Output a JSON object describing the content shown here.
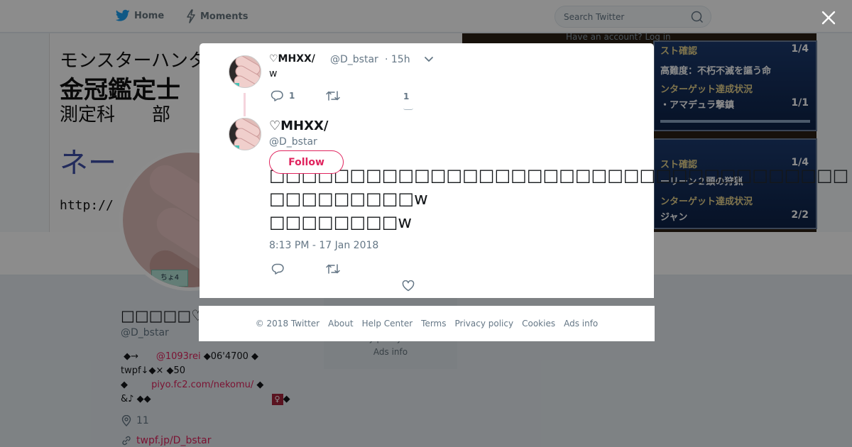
{
  "nav": {
    "home_label": "Home",
    "moments_label": "Moments",
    "search_placeholder": "Search Twitter",
    "login_hint": "Have an account? Log in"
  },
  "banner": {
    "line1": "モンスターハンタ",
    "line2": "金冠鑑定士",
    "line3": "測定科　　部",
    "line4": "ネー",
    "line5": "http://",
    "quest_title": "スト確認",
    "quest_count": "1/4",
    "quest_rank": "高難度：不朽不滅を謳う命",
    "target_status": "ンターゲット達成状況",
    "target_name1": "・アマデュラ撃鎮",
    "target_progress1": "1/1",
    "quest_name2": "ーリーン２頭の狩猟",
    "target_name2": "ジャン",
    "target_progress2": "2/2",
    "sticker": "ちょ4"
  },
  "profile": {
    "name": "□□□□□♡MH",
    "handle": "@D_bstar",
    "bio_lines": {
      "l1_a": " ◆→      ",
      "l1_link": "@1093rei",
      "l1_b": " ◆06'4700 ◆",
      "l2": "twpf↓◆× ◆50",
      "l3_a": "◆        ",
      "l3_link": "piyo.fc2.com/nekomu/",
      "l3_b": " ◆",
      "l4_a": "&♪ ◆◆",
      "l4_flag": "♀",
      "l4_b": "◆"
    },
    "location": "11",
    "website": "twpf.jp/D_bstar"
  },
  "sidebar_footer": {
    "line1": "Privacy policy  Cookies",
    "line2": "Ads info"
  },
  "parent_tweet": {
    "display_name": "♡MHXX/",
    "handle": "@D_bstar",
    "time": "· 15h",
    "text": "w",
    "reply_count": "1",
    "like_count": "1"
  },
  "main_tweet": {
    "display_name": "♡MHXX/",
    "handle": "@D_bstar",
    "follow_label": "Follow",
    "text": "□□□□□□□□□□□□□□□□□□□□□□□□□□□□□□□□□□□□\n□□□□□□□□□w\n□□□□□□□□w",
    "timestamp": "8:13 PM - 17 Jan 2018"
  },
  "footer": {
    "copyright": "© 2018 Twitter",
    "about": "About",
    "help": "Help Center",
    "terms": "Terms",
    "privacy": "Privacy policy",
    "cookies": "Cookies",
    "ads": "Ads info"
  },
  "colors": {
    "accent": "#e0245e",
    "twitter_blue": "#1da1f2",
    "muted": "#657786"
  },
  "icons": [
    "twitter-bird-icon",
    "lightning-icon",
    "search-icon",
    "close-icon",
    "chevron-down-icon",
    "reply-icon",
    "retweet-icon",
    "heart-icon",
    "location-icon",
    "link-icon"
  ]
}
